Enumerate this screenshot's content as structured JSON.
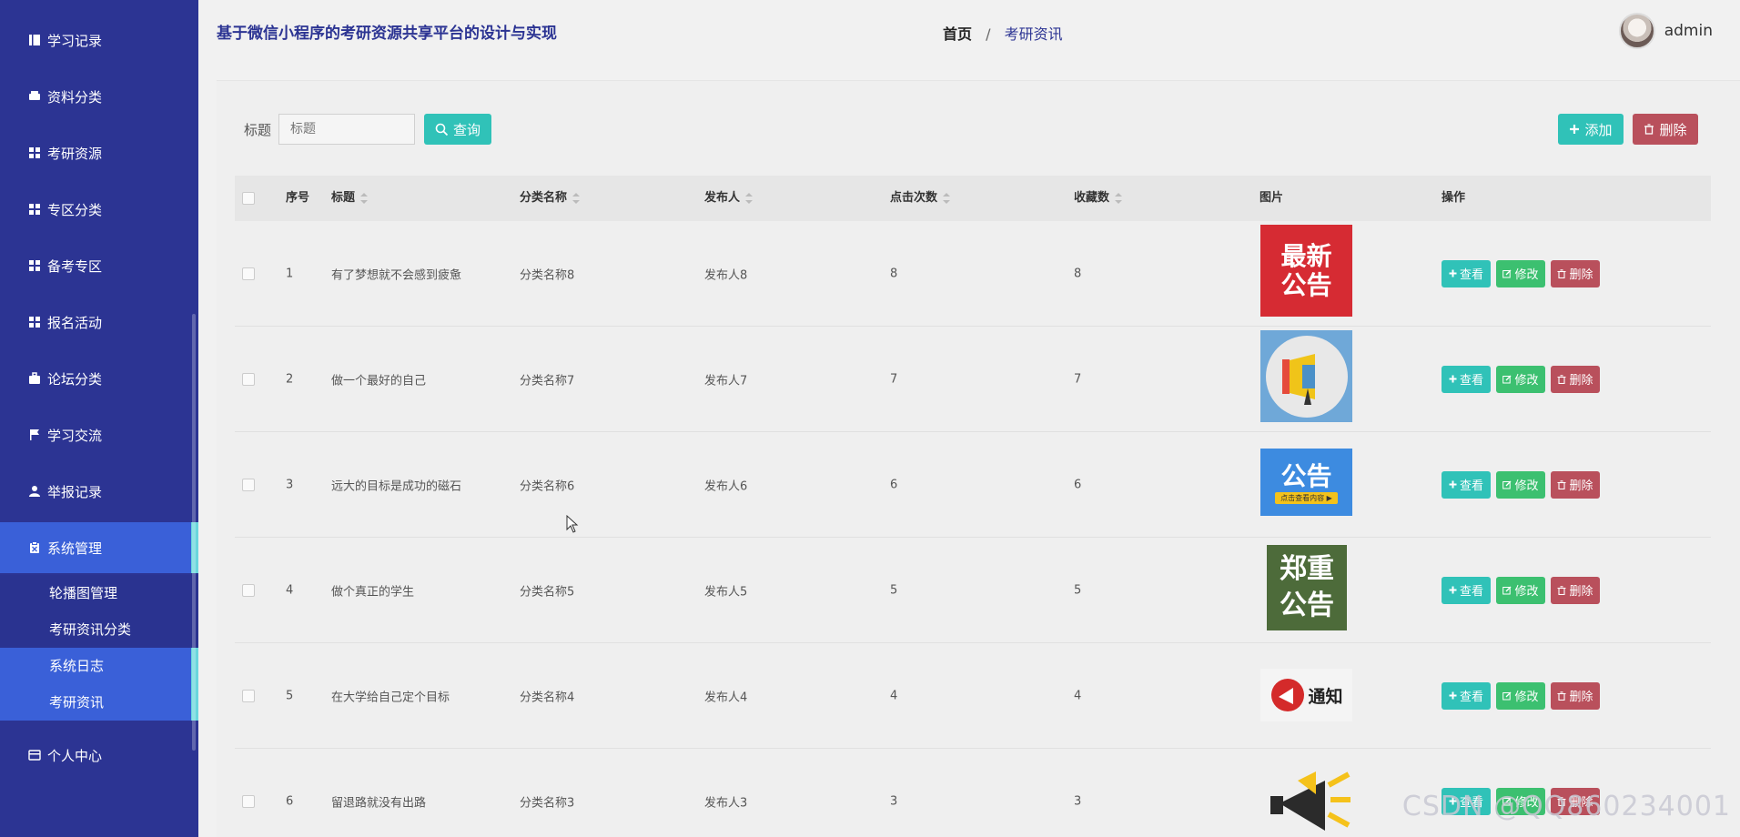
{
  "sidebar": {
    "items": [
      {
        "label": "学习记录",
        "icon": "book-icon"
      },
      {
        "label": "资料分类",
        "icon": "printer-icon"
      },
      {
        "label": "考研资源",
        "icon": "grid-icon"
      },
      {
        "label": "专区分类",
        "icon": "grid-icon"
      },
      {
        "label": "备考专区",
        "icon": "grid-icon"
      },
      {
        "label": "报名活动",
        "icon": "grid-icon"
      },
      {
        "label": "论坛分类",
        "icon": "briefcase-icon"
      },
      {
        "label": "学习交流",
        "icon": "flag-icon"
      },
      {
        "label": "举报记录",
        "icon": "user-icon"
      },
      {
        "label": "系统管理",
        "icon": "clipboard-icon"
      }
    ],
    "submenu": [
      {
        "label": "轮播图管理"
      },
      {
        "label": "考研资讯分类"
      },
      {
        "label": "系统日志"
      },
      {
        "label": "考研资讯"
      }
    ],
    "personal": {
      "label": "个人中心",
      "icon": "card-icon"
    }
  },
  "header": {
    "title": "基于微信小程序的考研资源共享平台的设计与实现",
    "breadcrumb_home": "首页",
    "breadcrumb_sep": "/",
    "breadcrumb_current": "考研资讯",
    "username": "admin"
  },
  "search": {
    "label": "标题",
    "placeholder": "标题",
    "query_label": "查询"
  },
  "toolbar": {
    "add_label": "添加",
    "delete_label": "删除"
  },
  "table": {
    "columns": [
      "序号",
      "标题",
      "分类名称",
      "发布人",
      "点击次数",
      "收藏数",
      "图片",
      "操作"
    ],
    "rows": [
      {
        "index": "1",
        "title": "有了梦想就不会感到疲惫",
        "category": "分类名称8",
        "publisher": "发布人8",
        "clicks": "8",
        "favorites": "8",
        "image_text": [
          "最新",
          "公告"
        ]
      },
      {
        "index": "2",
        "title": "做一个最好的自己",
        "category": "分类名称7",
        "publisher": "发布人7",
        "clicks": "7",
        "favorites": "7",
        "image_text": []
      },
      {
        "index": "3",
        "title": "远大的目标是成功的磁石",
        "category": "分类名称6",
        "publisher": "发布人6",
        "clicks": "6",
        "favorites": "6",
        "image_text": [
          "公告",
          "点击查看内容 ▶"
        ]
      },
      {
        "index": "4",
        "title": "做个真正的学生",
        "category": "分类名称5",
        "publisher": "发布人5",
        "clicks": "5",
        "favorites": "5",
        "image_text": [
          "郑重",
          "公告"
        ]
      },
      {
        "index": "5",
        "title": "在大学给自己定个目标",
        "category": "分类名称4",
        "publisher": "发布人4",
        "clicks": "4",
        "favorites": "4",
        "image_text": [
          "通知"
        ]
      },
      {
        "index": "6",
        "title": "留退路就没有出路",
        "category": "分类名称3",
        "publisher": "发布人3",
        "clicks": "3",
        "favorites": "3",
        "image_text": []
      }
    ],
    "ops": {
      "view": "查看",
      "edit": "修改",
      "delete": "删除"
    }
  },
  "watermark": "CSDN @QQ860234001",
  "colors": {
    "sidebar_bg": "#2c3493",
    "active_bg": "#3a60d8",
    "active_bar": "#6ad7dc",
    "primary": "#30c2b8",
    "success": "#3cc070",
    "danger": "#b9505c"
  }
}
